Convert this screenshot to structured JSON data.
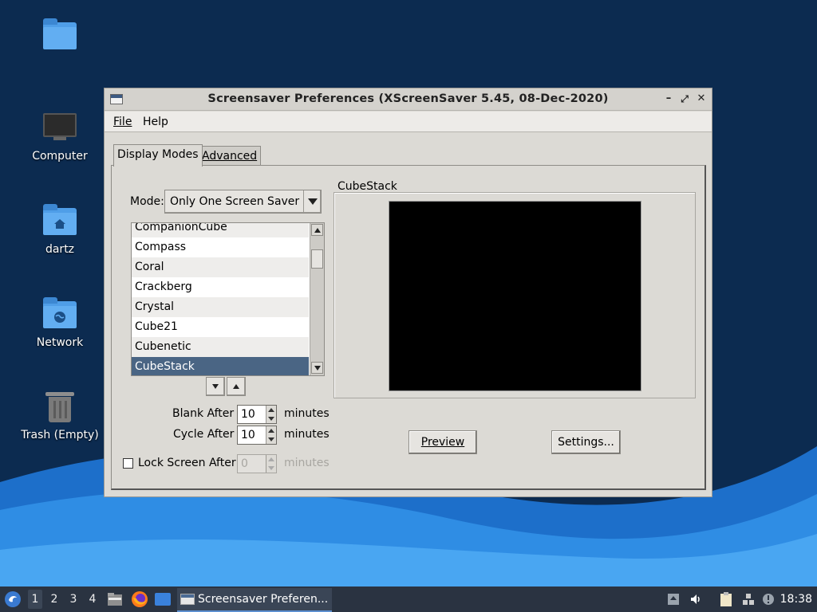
{
  "desktop": {
    "icons": [
      {
        "label": "",
        "icon": "folder-icon"
      },
      {
        "label": "Computer",
        "icon": "computer-icon"
      },
      {
        "label": "dartz",
        "icon": "home-folder-icon"
      },
      {
        "label": "Network",
        "icon": "network-folder-icon"
      },
      {
        "label": "Trash (Empty)",
        "icon": "trash-icon"
      }
    ]
  },
  "window": {
    "title": "Screensaver Preferences  (XScreenSaver 5.45, 08-Dec-2020)",
    "controls": {
      "minimize": "–",
      "maximize": "⤢",
      "close": "✕"
    },
    "menu": {
      "file": "File",
      "help": "Help"
    },
    "tabs": [
      {
        "label": "Display Modes",
        "active": true
      },
      {
        "label": "Advanced",
        "active": false
      }
    ],
    "mode": {
      "label": "Mode:",
      "value": "Only One Screen Saver"
    },
    "list": {
      "items": [
        "CompanionCube",
        "Compass",
        "Coral",
        "Crackberg",
        "Crystal",
        "Cube21",
        "Cubenetic",
        "CubeStack"
      ],
      "selected": "CubeStack"
    },
    "blank_after": {
      "label": "Blank After",
      "value": "10",
      "unit": "minutes"
    },
    "cycle_after": {
      "label": "Cycle After",
      "value": "10",
      "unit": "minutes"
    },
    "lock_after": {
      "label": "Lock Screen After",
      "value": "0",
      "unit": "minutes",
      "checked": false
    },
    "preview": {
      "label": "CubeStack",
      "preview_button": "Preview",
      "settings_button": "Settings..."
    }
  },
  "taskbar": {
    "workspaces": [
      "1",
      "2",
      "3",
      "4"
    ],
    "active_workspace": "1",
    "task_label": "Screensaver Preferen...",
    "clock": "18:38"
  },
  "colors": {
    "selection": "#4a6584",
    "desktop_dark": "#0b2a4e",
    "desktop_wave": "#2f8de4",
    "taskbar": "#2a3341"
  }
}
